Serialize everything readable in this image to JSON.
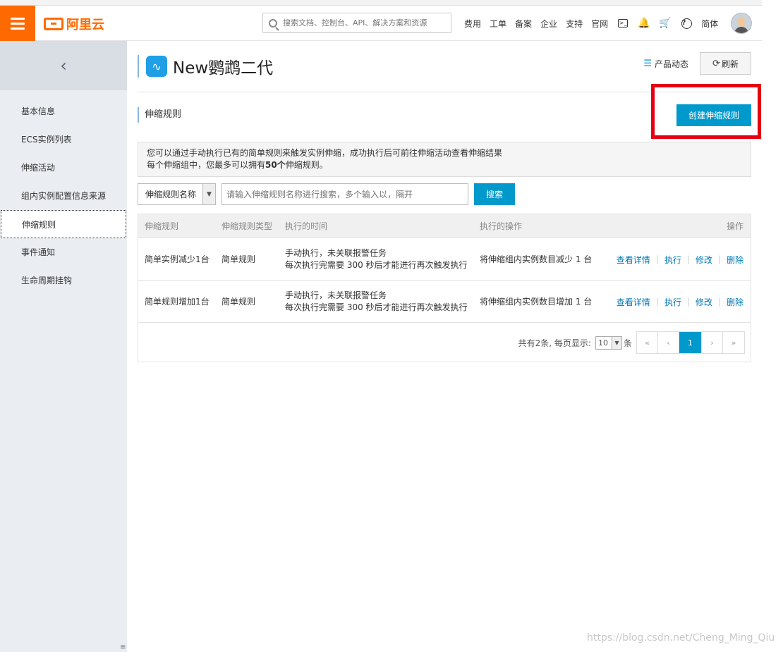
{
  "header": {
    "logo_text": "阿里云",
    "search_placeholder": "搜索文档、控制台、API、解决方案和资源",
    "nav": [
      "费用",
      "工单",
      "备案",
      "企业",
      "支持",
      "官网"
    ],
    "lang": "简体"
  },
  "sidebar": {
    "back_glyph": "‹",
    "items": [
      {
        "label": "基本信息"
      },
      {
        "label": "ECS实例列表"
      },
      {
        "label": "伸缩活动"
      },
      {
        "label": "组内实例配置信息来源"
      },
      {
        "label": "伸缩规则",
        "active": true
      },
      {
        "label": "事件通知"
      },
      {
        "label": "生命周期挂钩"
      }
    ]
  },
  "page": {
    "title": "New鹦鹉二代",
    "product_updates": "产品动态",
    "refresh": "刷新",
    "section_title": "伸缩规则",
    "create_button": "创建伸缩规则",
    "notice_line1": "您可以通过手动执行已有的简单规则来触发实例伸缩，成功执行后可前往伸缩活动查看伸缩结果",
    "notice_line2_prefix": "每个伸缩组中，您最多可以拥有",
    "notice_line2_bold": "50个",
    "notice_line2_suffix": "伸缩规则。"
  },
  "filter": {
    "select_value": "伸缩规则名称",
    "input_placeholder": "请输入伸缩规则名称进行搜索，多个输入以，隔开",
    "search_button": "搜索"
  },
  "table": {
    "headers": [
      "伸缩规则",
      "伸缩规则类型",
      "执行的时间",
      "执行的操作",
      "操作"
    ],
    "rows": [
      {
        "name": "简单实例减少1台",
        "type": "简单规则",
        "time_line1": "手动执行，未关联报警任务",
        "time_line2": "每次执行完需要 300 秒后才能进行再次触发执行",
        "action": "将伸缩组内实例数目减少 1 台"
      },
      {
        "name": "简单规则增加1台",
        "type": "简单规则",
        "time_line1": "手动执行，未关联报警任务",
        "time_line2": "每次执行完需要 300 秒后才能进行再次触发执行",
        "action": "将伸缩组内实例数目增加 1 台"
      }
    ],
    "ops": [
      "查看详情",
      "执行",
      "修改",
      "删除"
    ]
  },
  "pagination": {
    "total_text": "共有2条, 每页显示:",
    "page_size": "10",
    "unit": "条",
    "first": "«",
    "prev": "‹",
    "current": "1",
    "next": "›",
    "last": "»"
  },
  "watermark": "https://blog.csdn.net/Cheng_Ming_Qiu",
  "colors": {
    "brand": "#ff6a00",
    "primary": "#0099cc",
    "highlight": "#e60012"
  }
}
